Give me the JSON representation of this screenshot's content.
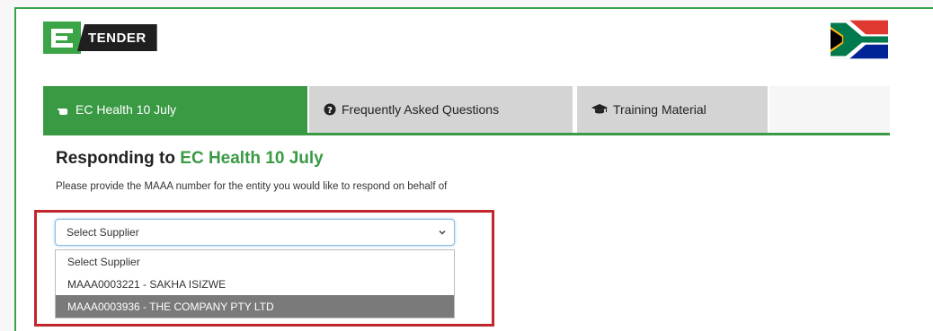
{
  "logo": {
    "text": "TENDER"
  },
  "tabs": [
    {
      "label": "EC Health 10 July",
      "icon": "hand-pointer-icon",
      "active": true
    },
    {
      "label": "Frequently Asked Questions",
      "icon": "question-circle-icon",
      "active": false
    },
    {
      "label": "Training Material",
      "icon": "graduation-cap-icon",
      "active": false
    }
  ],
  "heading": {
    "prefix": "Responding to",
    "tender_name": "EC Health 10 July"
  },
  "instruction": "Please provide the MAAA number for the entity you would like to respond on behalf of",
  "supplier_select": {
    "value": "Select Supplier",
    "options": [
      "Select Supplier",
      "MAAA0003221 - SAKHA ISIZWE",
      "MAAA0003936 - THE COMPANY PTY LTD"
    ],
    "highlighted_index": 2
  },
  "colors": {
    "brand_green": "#3a9a44",
    "highlight_red": "#c0262c",
    "tab_gray": "#d4d4d4"
  }
}
